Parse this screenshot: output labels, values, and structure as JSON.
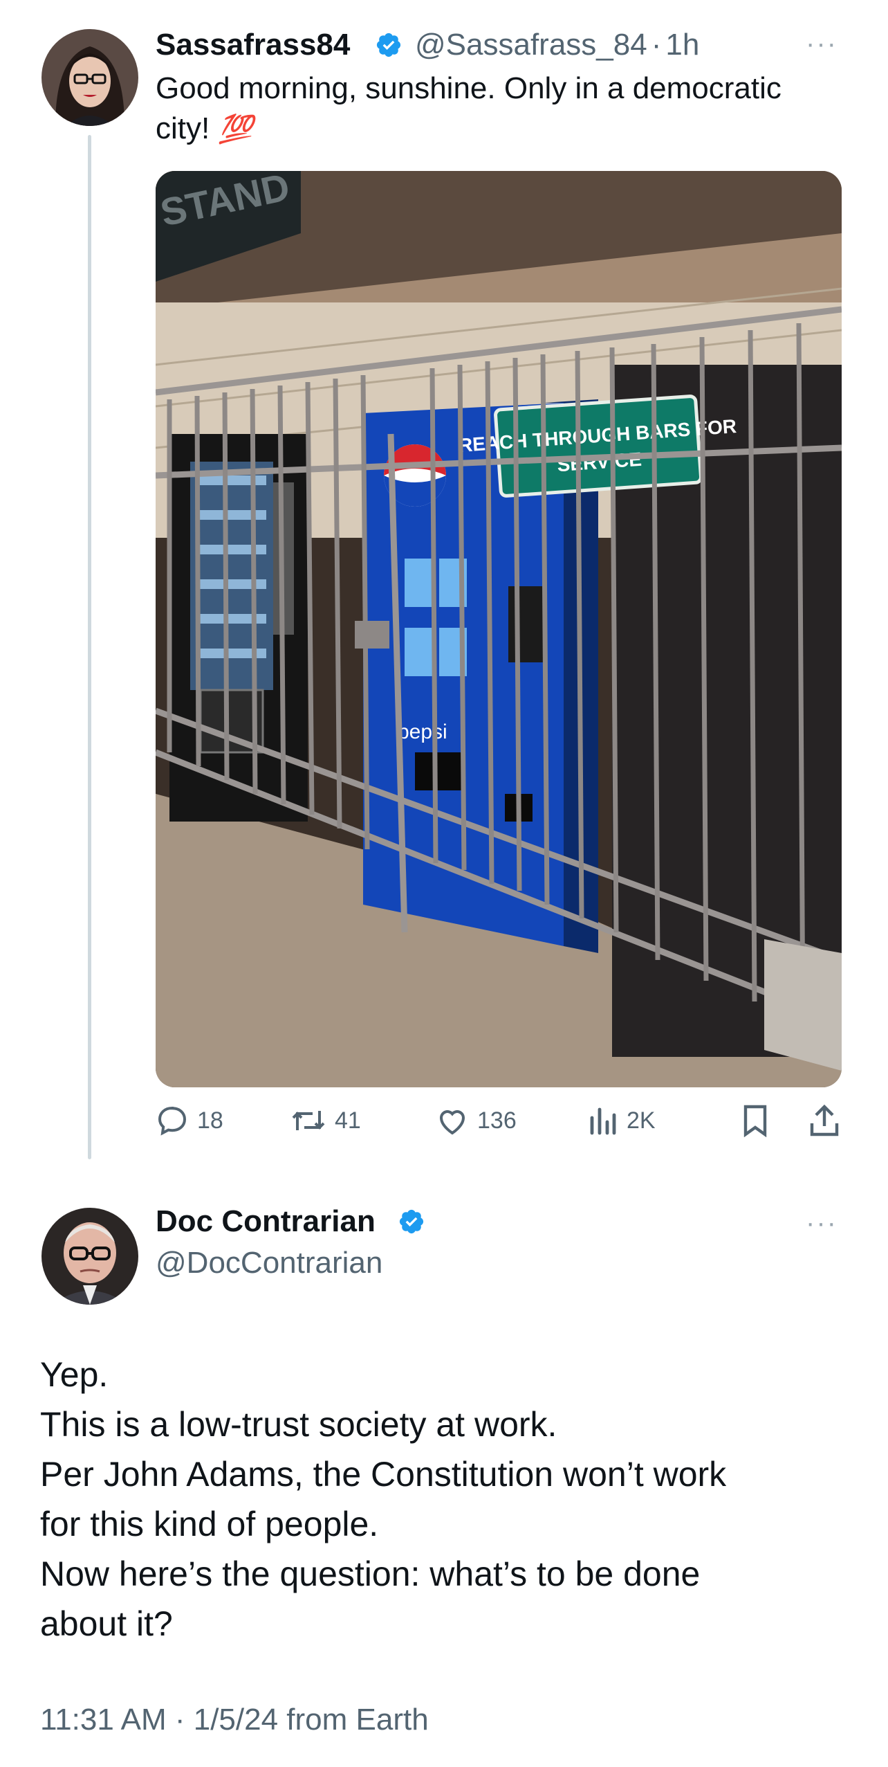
{
  "tweet": {
    "author_name": "Sassafrass84",
    "handle": "@Sassafrass_84",
    "separator": "·",
    "time": "1h",
    "more_label": "···",
    "text_line1": "Good morning, sunshine. Only in a democratic",
    "text_line2": "city!",
    "emoji": "💯",
    "photo": {
      "sign_text_line1": "REACH THROUGH BARS FOR",
      "sign_text_line2": "SERVICE",
      "top_sign_text": "STAND",
      "brand_text": "pepsi"
    },
    "stats": {
      "replies": "18",
      "reposts": "41",
      "likes": "136",
      "views": "2K"
    }
  },
  "reply": {
    "author_name": "Doc Contrarian",
    "handle": "@DocContrarian",
    "more_label": "···",
    "lines": [
      "Yep.",
      "This is a low-trust society at work.",
      "Per John Adams, the Constitution won’t work",
      "for this kind of people.",
      "Now here’s the question: what’s to be done",
      "about it?"
    ],
    "timestamp": "11:31 AM · 1/5/24 from Earth"
  },
  "colors": {
    "verified": "#1d9bf0",
    "secondary_text": "#536471",
    "sign_green": "#0e7a67",
    "pepsi_blue": "#1346b8"
  }
}
